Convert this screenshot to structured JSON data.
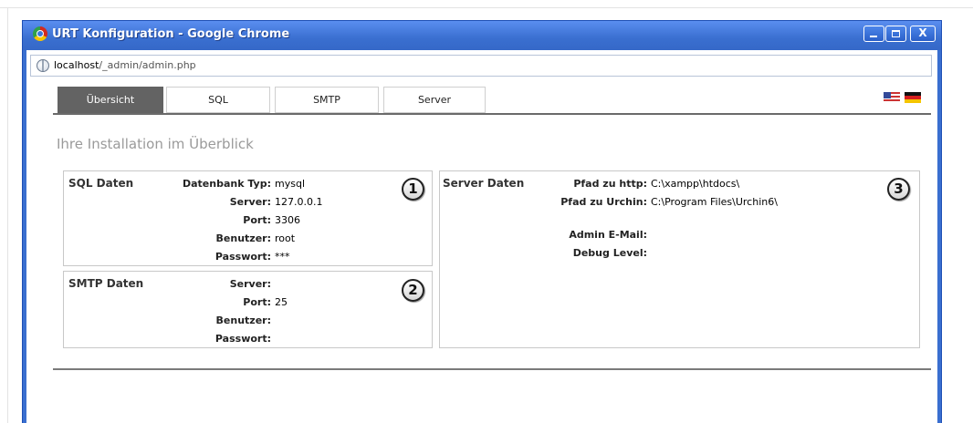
{
  "window": {
    "title": "URT Konfiguration - Google Chrome",
    "controls": {
      "minimize": "_",
      "maximize": "□",
      "close": "X"
    }
  },
  "address": {
    "host": "localhost",
    "path": "/_admin/admin.php"
  },
  "tabs": [
    {
      "label": "Übersicht",
      "active": true
    },
    {
      "label": "SQL",
      "active": false
    },
    {
      "label": "SMTP",
      "active": false
    },
    {
      "label": "Server",
      "active": false
    }
  ],
  "languages": [
    "en-flag",
    "de-flag"
  ],
  "section": {
    "title": "Ihre Installation im Überblick"
  },
  "sql": {
    "title": "SQL Daten",
    "callout": "1",
    "rows": [
      {
        "key": "Datenbank Typ:",
        "value": "mysql"
      },
      {
        "key": "Server:",
        "value": "127.0.0.1"
      },
      {
        "key": "Port:",
        "value": "3306"
      },
      {
        "key": "Benutzer:",
        "value": "root"
      },
      {
        "key": "Passwort:",
        "value": "***"
      }
    ]
  },
  "smtp": {
    "title": "SMTP Daten",
    "callout": "2",
    "rows": [
      {
        "key": "Server:",
        "value": ""
      },
      {
        "key": "Port:",
        "value": "25"
      },
      {
        "key": "Benutzer:",
        "value": ""
      },
      {
        "key": "Passwort:",
        "value": ""
      }
    ]
  },
  "server": {
    "title": "Server Daten",
    "callout": "3",
    "rows": [
      {
        "key": "Pfad zu http:",
        "value": "C:\\xampp\\htdocs\\"
      },
      {
        "key": "Pfad zu Urchin:",
        "value": "C:\\Program Files\\Urchin6\\"
      },
      {
        "key": "Admin E-Mail:",
        "value": ""
      },
      {
        "key": "Debug Level:",
        "value": ""
      }
    ]
  },
  "colors": {
    "titlebar": "#3a6fd0",
    "active_tab": "#636363",
    "section_title": "#9a9a9a"
  }
}
